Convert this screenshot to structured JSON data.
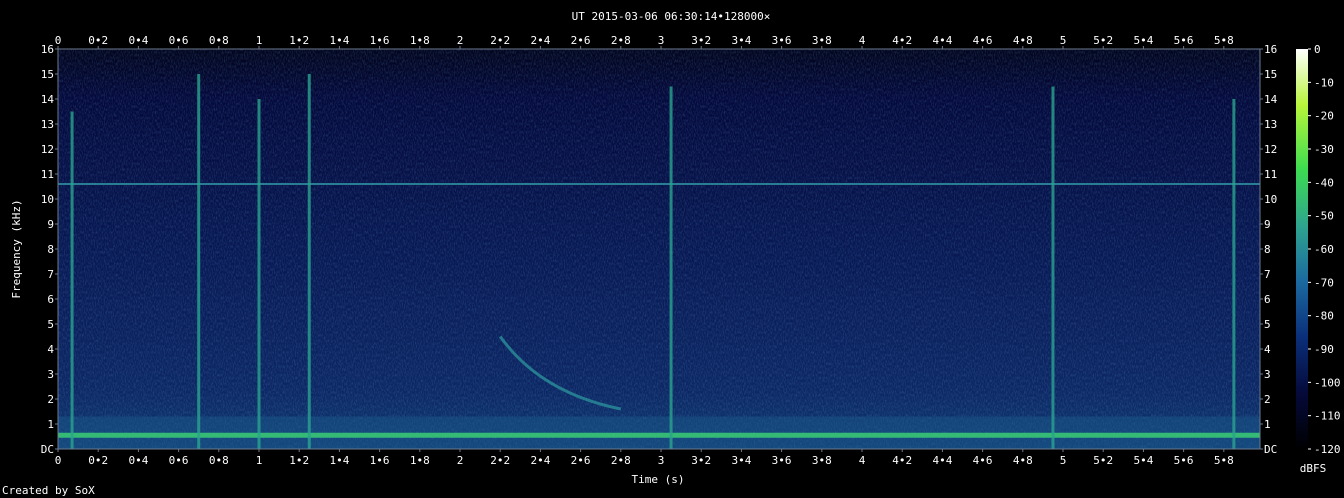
{
  "chart_data": {
    "type": "heatmap",
    "title": "UT 2015-03-06 06:30:14•128000×",
    "xlabel": "Time (s)",
    "ylabel": "Frequency (kHz)",
    "xlim": [
      0,
      5.98
    ],
    "ylim": [
      0,
      16
    ],
    "x_ticks": [
      "0",
      "0•2",
      "0•4",
      "0•6",
      "0•8",
      "1",
      "1•2",
      "1•4",
      "1•6",
      "1•8",
      "2",
      "2•2",
      "2•4",
      "2•6",
      "2•8",
      "3",
      "3•2",
      "3•4",
      "3•6",
      "3•8",
      "4",
      "4•2",
      "4•4",
      "4•6",
      "4•8",
      "5",
      "5•2",
      "5•4",
      "5•6",
      "5•8"
    ],
    "y_ticks": [
      "DC",
      "1",
      "2",
      "3",
      "4",
      "5",
      "6",
      "7",
      "8",
      "9",
      "10",
      "11",
      "12",
      "13",
      "14",
      "15",
      "16"
    ],
    "colorbar": {
      "label": "dBFS",
      "ticks": [
        "0",
        "-10",
        "-20",
        "-30",
        "-40",
        "-50",
        "-60",
        "-70",
        "-80",
        "-90",
        "-100",
        "-110",
        "-120"
      ],
      "range": [
        -120,
        0
      ],
      "colors": [
        "#000000",
        "#050a3a",
        "#0a2f7a",
        "#1b6aa0",
        "#2ea58e",
        "#3ddc50",
        "#b8f53a",
        "#ffffff"
      ]
    },
    "features": {
      "constant_tones_khz": [
        0.55,
        10.6
      ],
      "transients": [
        {
          "t": 0.07,
          "top_khz": 13.5
        },
        {
          "t": 0.7,
          "top_khz": 15.0
        },
        {
          "t": 1.0,
          "top_khz": 14.0
        },
        {
          "t": 1.25,
          "top_khz": 15.0
        },
        {
          "t": 3.05,
          "top_khz": 14.5
        },
        {
          "t": 4.95,
          "top_khz": 14.5
        },
        {
          "t": 5.85,
          "top_khz": 14.0
        }
      ],
      "descending_sweep": {
        "t_start": 2.2,
        "f_start_khz": 4.5,
        "t_end": 2.8,
        "f_end_khz": 1.6
      }
    }
  },
  "footer": {
    "credit": "Created by SoX"
  }
}
